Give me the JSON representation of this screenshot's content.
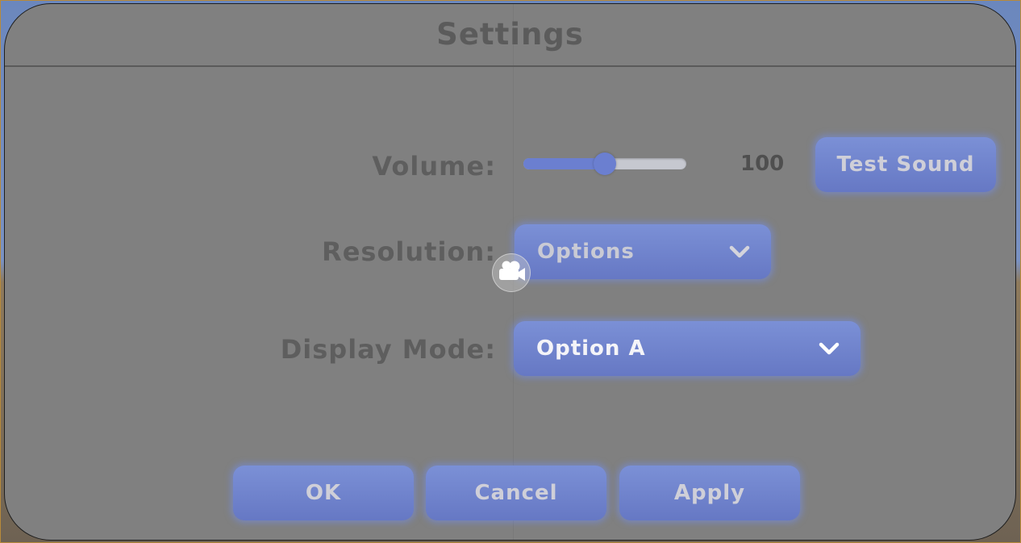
{
  "dialog": {
    "title": "Settings"
  },
  "volume": {
    "label": "Volume:",
    "value_text": "100",
    "slider_fraction": 0.5,
    "test_button": "Test Sound"
  },
  "resolution": {
    "label": "Resolution:",
    "selected": "Options",
    "chevron_icon": "chevron-down-icon"
  },
  "display_mode": {
    "label": "Display Mode:",
    "selected": "Option A",
    "chevron_icon": "chevron-down-icon"
  },
  "footer": {
    "ok_label": "OK",
    "cancel_label": "Cancel",
    "apply_label": "Apply"
  },
  "overlay": {
    "icon": "video-camera-icon"
  },
  "colors": {
    "panel_bg": "#808080",
    "accent": "#6b7fd0",
    "button_text": "#cfcfd8",
    "label_text": "#5e5e5e"
  }
}
